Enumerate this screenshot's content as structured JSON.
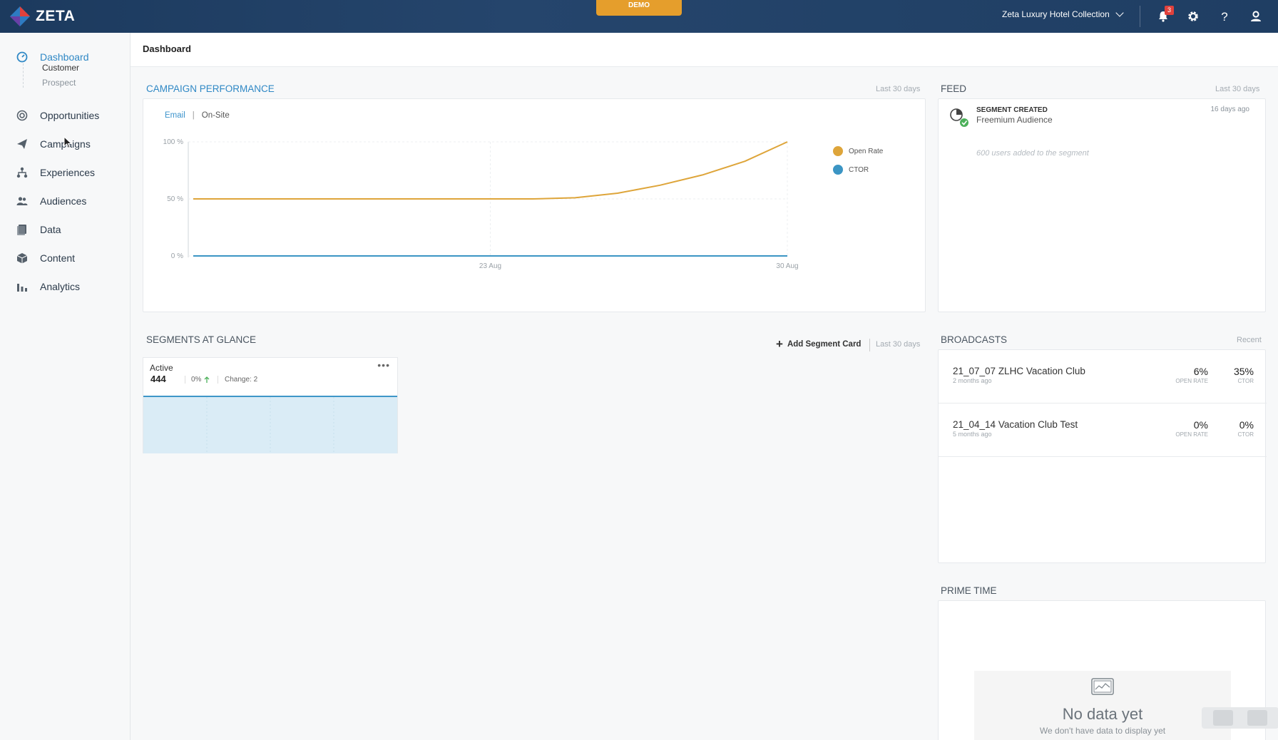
{
  "topbar": {
    "brand": "ZETA",
    "demo_label": "DEMO",
    "org_name": "Zeta Luxury Hotel Collection",
    "notification_count": "3",
    "icons": [
      "bell-icon",
      "gear-icon",
      "help-icon",
      "user-icon"
    ]
  },
  "sidebar": {
    "items": [
      {
        "label": "Dashboard",
        "icon": "dashboard-icon",
        "active": true
      },
      {
        "label": "Opportunities",
        "icon": "target-icon"
      },
      {
        "label": "Campaigns",
        "icon": "paper-plane-icon"
      },
      {
        "label": "Experiences",
        "icon": "flow-icon"
      },
      {
        "label": "Audiences",
        "icon": "people-icon"
      },
      {
        "label": "Data",
        "icon": "database-icon"
      },
      {
        "label": "Content",
        "icon": "cube-icon"
      },
      {
        "label": "Analytics",
        "icon": "bar-chart-icon"
      }
    ],
    "sub_items": [
      {
        "label": "Customer"
      },
      {
        "label": "Prospect"
      }
    ]
  },
  "page": {
    "title": "Dashboard"
  },
  "campaign_performance": {
    "title": "CAMPAIGN PERFORMANCE",
    "meta": "Last 30 days",
    "tabs": {
      "email": "Email",
      "separator": "|",
      "onsite": "On-Site"
    }
  },
  "chart_data": {
    "type": "line",
    "title": "",
    "x_ticks": [
      "23 Aug",
      "30 Aug"
    ],
    "y_ticks": [
      "100 %",
      "50 %",
      "0 %"
    ],
    "ylim": [
      0,
      100
    ],
    "x": [
      0,
      1,
      2,
      3,
      4,
      5,
      6,
      7,
      8,
      9,
      10,
      11,
      12,
      13,
      14
    ],
    "series": [
      {
        "name": "Open Rate",
        "color": "#dea53a",
        "values": [
          50,
          50,
          50,
          50,
          50,
          50,
          50,
          50,
          50,
          51,
          55,
          62,
          71,
          83,
          100
        ]
      },
      {
        "name": "CTOR",
        "color": "#3b95c4",
        "values": [
          0,
          0,
          0,
          0,
          0,
          0,
          0,
          0,
          0,
          0,
          0,
          0,
          0,
          0,
          0
        ]
      }
    ],
    "legend": "right",
    "grid": true
  },
  "feed": {
    "title": "FEED",
    "meta": "Last 30 days",
    "item": {
      "type": "SEGMENT CREATED",
      "name": "Freemium Audience",
      "time": "16 days ago",
      "description": "600 users added to the segment"
    }
  },
  "segments": {
    "title": "SEGMENTS AT GLANCE",
    "add_label": "Add Segment Card",
    "meta": "Last 30 days",
    "card": {
      "name": "Active",
      "count": "444",
      "pct": "0%",
      "change": "Change: 2",
      "menu": "•••"
    }
  },
  "broadcasts": {
    "title": "BROADCASTS",
    "meta": "Recent",
    "open_rate_label": "OPEN RATE",
    "ctor_label": "CTOR",
    "rows": [
      {
        "name": "21_07_07 ZLHC Vacation Club",
        "time": "2 months ago",
        "open_rate": "6%",
        "ctor": "35%"
      },
      {
        "name": "21_04_14 Vacation Club Test",
        "time": "5 months ago",
        "open_rate": "0%",
        "ctor": "0%"
      }
    ]
  },
  "prime_time": {
    "title": "PRIME TIME",
    "empty_title": "No data yet",
    "empty_sub": "We don't have data to display yet"
  },
  "colors": {
    "accent": "#2f88c5",
    "topbar": "#1f3e63",
    "demo": "#e59e2c",
    "open_rate": "#dea53a",
    "ctor": "#3b95c4"
  }
}
